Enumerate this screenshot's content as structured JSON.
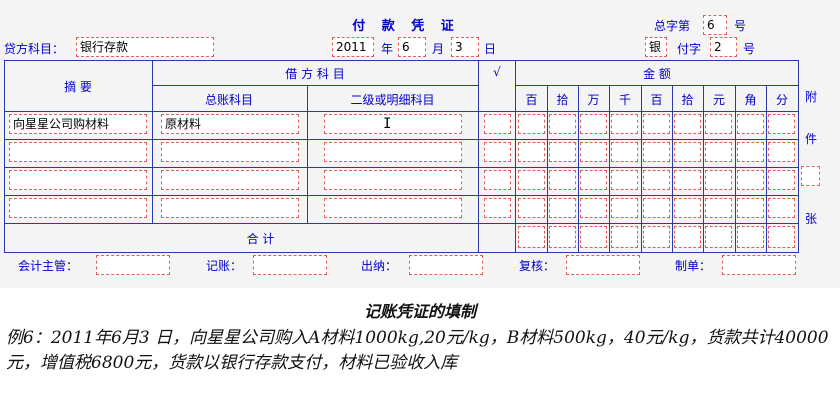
{
  "voucher": {
    "title": "付 款 凭 证",
    "total_no_label": "总字第",
    "total_no_value": "6",
    "hao_label": "号",
    "credit_account_label": "贷方科目：",
    "credit_account_value": "银行存款",
    "date": {
      "year": "2011",
      "year_label": "年",
      "month": "6",
      "month_label": "月",
      "day": "3",
      "day_label": "日"
    },
    "fu_char": "银",
    "fu_label": "付字",
    "fu_no": "2",
    "fu_hao_label": "号"
  },
  "table": {
    "summary_header": "摘 要",
    "debit_header": "借 方 科 目",
    "general_ledger_header": "总账科目",
    "detail_header": "二级或明细科目",
    "check_header": "√",
    "amount_header": "金 额",
    "digit_headers": [
      "百",
      "拾",
      "万",
      "千",
      "百",
      "拾",
      "元",
      "角",
      "分"
    ],
    "rows": [
      {
        "summary": "向星星公司购材料",
        "general": "原材料",
        "detail": ""
      },
      {
        "summary": "",
        "general": "",
        "detail": ""
      },
      {
        "summary": "",
        "general": "",
        "detail": ""
      },
      {
        "summary": "",
        "general": "",
        "detail": ""
      }
    ],
    "total_label": "合 计",
    "attachment_chars": [
      "附",
      "件",
      "张"
    ]
  },
  "signatures": {
    "accounting_supervisor": "会计主管：",
    "bookkeeping": "记账：",
    "cashier": "出纳：",
    "review": "复核：",
    "preparer": "制单："
  },
  "caption": {
    "title": "记账凭证的填制",
    "body": "例6：2011年6月3 日，向星星公司购入A材料1000kg,20元/kg，B材料500kg，40元/kg，货款共计40000元，增值税6800元，货款以银行存款支付，材料已验收入库"
  }
}
